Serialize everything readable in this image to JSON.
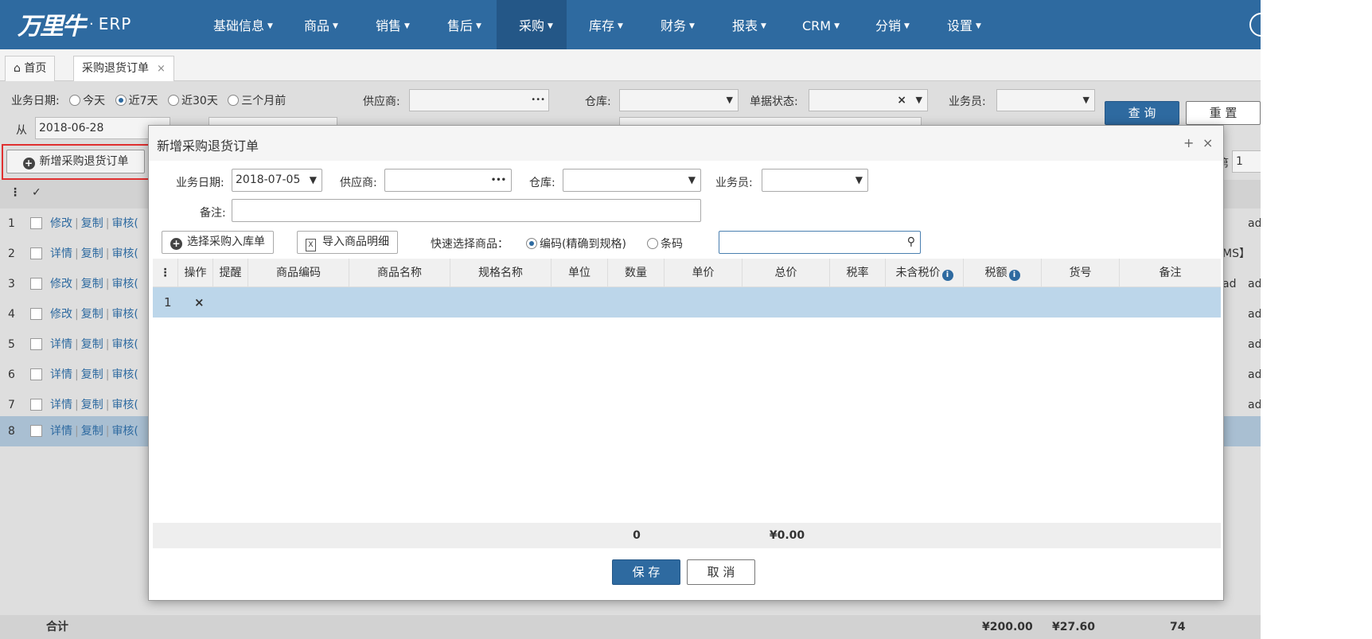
{
  "brand": {
    "logo_text": "万里牛",
    "dot": "·",
    "product": "ERP"
  },
  "nav": [
    {
      "label": "基础信息"
    },
    {
      "label": "商品"
    },
    {
      "label": "销售"
    },
    {
      "label": "售后"
    },
    {
      "label": "采购",
      "active": true
    },
    {
      "label": "库存"
    },
    {
      "label": "财务"
    },
    {
      "label": "报表"
    },
    {
      "label": "CRM"
    },
    {
      "label": "分销"
    },
    {
      "label": "设置"
    }
  ],
  "tabs": {
    "home": "首页",
    "current": "采购退货订单",
    "close": "×"
  },
  "filters": {
    "date_label": "业务日期:",
    "date_options": [
      "今天",
      "近7天",
      "近30天",
      "三个月前"
    ],
    "selected_date": "近7天",
    "supplier_label": "供应商:",
    "warehouse_label": "仓库:",
    "status_label": "单据状态:",
    "status_clear": "×",
    "clerk_label": "业务员:",
    "from_label": "从",
    "from_value": "2018-06-28",
    "query_button": "查 询",
    "reset_button": "重 置",
    "page_label": "第",
    "page_value": "1"
  },
  "list": {
    "new_button": "新增采购退货订单",
    "check_header": "✓",
    "row_actions": [
      {
        "idx": "1",
        "a": "修改",
        "b": "复制",
        "c": "审核("
      },
      {
        "idx": "2",
        "a": "详情",
        "b": "复制",
        "c": "审核("
      },
      {
        "idx": "3",
        "a": "修改",
        "b": "复制",
        "c": "审核("
      },
      {
        "idx": "4",
        "a": "修改",
        "b": "复制",
        "c": "审核("
      },
      {
        "idx": "5",
        "a": "详情",
        "b": "复制",
        "c": "审核("
      },
      {
        "idx": "6",
        "a": "详情",
        "b": "复制",
        "c": "审核("
      },
      {
        "idx": "7",
        "a": "详情",
        "b": "复制",
        "c": "审核("
      },
      {
        "idx": "8",
        "a": "详情",
        "b": "复制",
        "c": "审核("
      }
    ],
    "row_tail": [
      "ad",
      "MS】ad",
      "ad",
      "ad",
      "ad",
      "ad",
      "ad"
    ],
    "total_label": "合计",
    "total_amount": "¥200.00",
    "total_tax": "¥27.60",
    "total_qty": "74"
  },
  "dialog": {
    "title": "新增采购退货订单",
    "max": "+",
    "close": "×",
    "date_label": "业务日期:",
    "date_value": "2018-07-05",
    "supplier_label": "供应商:",
    "dots": "•••",
    "warehouse_label": "仓库:",
    "clerk_label": "业务员:",
    "note_label": "备注:",
    "select_in_button": "选择采购入库单",
    "import_button": "导入商品明细",
    "quick_label": "快速选择商品：",
    "quick_options": [
      "编码(精确到规格)",
      "条码"
    ],
    "columns": [
      "操作",
      "提醒",
      "商品编码",
      "商品名称",
      "规格名称",
      "单位",
      "数量",
      "单价",
      "总价",
      "税率",
      "未含税价",
      "税额",
      "货号",
      "备注"
    ],
    "row1_idx": "1",
    "row1_delete": "×",
    "foot_qty": "0",
    "foot_total": "¥0.00",
    "save_button": "保 存",
    "cancel_button": "取 消"
  }
}
